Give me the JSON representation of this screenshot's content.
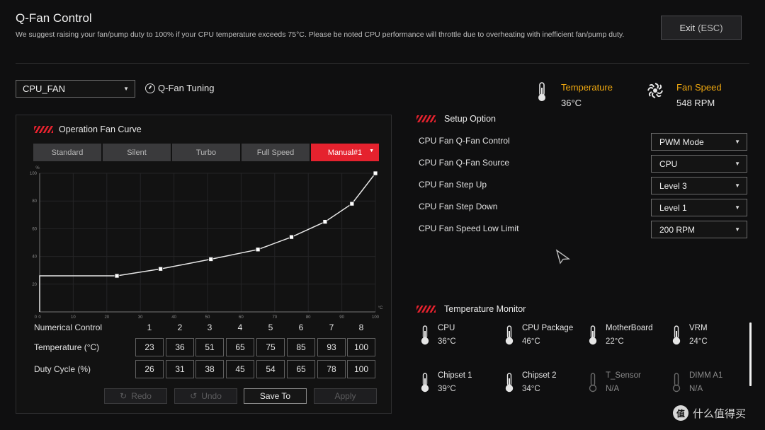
{
  "header": {
    "title": "Q-Fan Control",
    "subtitle": "We suggest raising your fan/pump duty to 100% if your CPU temperature exceeds 75°C. Please be noted CPU performance will throttle due to overheating with inefficient fan/pump duty.",
    "exit_label": "Exit",
    "exit_key": "(ESC)"
  },
  "fan_selector": {
    "value": "CPU_FAN"
  },
  "qfan_tuning_label": "Q-Fan Tuning",
  "stats": {
    "temperature_label": "Temperature",
    "temperature_value": "36°C",
    "fan_speed_label": "Fan Speed",
    "fan_speed_value": "548 RPM"
  },
  "curve_panel": {
    "title": "Operation Fan Curve",
    "tabs": [
      "Standard",
      "Silent",
      "Turbo",
      "Full Speed",
      "Manual#1"
    ],
    "active_tab": 4
  },
  "chart_data": {
    "type": "line",
    "title": "",
    "xlabel": "",
    "ylabel": "",
    "x_unit": "°C",
    "y_unit": "%",
    "xlim": [
      0,
      100
    ],
    "ylim": [
      0,
      100
    ],
    "xticks": [
      0,
      10,
      20,
      30,
      40,
      50,
      60,
      70,
      80,
      90,
      100
    ],
    "yticks": [
      20,
      40,
      60,
      80,
      100
    ],
    "points": [
      {
        "x": 23,
        "y": 26
      },
      {
        "x": 36,
        "y": 31
      },
      {
        "x": 51,
        "y": 38
      },
      {
        "x": 65,
        "y": 45
      },
      {
        "x": 75,
        "y": 54
      },
      {
        "x": 85,
        "y": 65
      },
      {
        "x": 93,
        "y": 78
      },
      {
        "x": 100,
        "y": 100
      }
    ],
    "grid": true
  },
  "numerical_control": {
    "label": "Numerical Control",
    "indices": [
      "1",
      "2",
      "3",
      "4",
      "5",
      "6",
      "7",
      "8"
    ],
    "temperature_label": "Temperature (°C)",
    "temperatures": [
      "23",
      "36",
      "51",
      "65",
      "75",
      "85",
      "93",
      "100"
    ],
    "duty_label": "Duty Cycle (%)",
    "duties": [
      "26",
      "31",
      "38",
      "45",
      "54",
      "65",
      "78",
      "100"
    ]
  },
  "actions": {
    "redo": "Redo",
    "undo": "Undo",
    "save": "Save To",
    "apply": "Apply"
  },
  "setup": {
    "title": "Setup Option",
    "options": [
      {
        "label": "CPU Fan Q-Fan Control",
        "value": "PWM Mode"
      },
      {
        "label": "CPU Fan Q-Fan Source",
        "value": "CPU"
      },
      {
        "label": "CPU Fan Step Up",
        "value": "Level 3"
      },
      {
        "label": "CPU Fan Step Down",
        "value": "Level 1"
      },
      {
        "label": "CPU Fan Speed Low Limit",
        "value": "200 RPM"
      }
    ]
  },
  "monitor": {
    "title": "Temperature Monitor",
    "items": [
      {
        "name": "CPU",
        "value": "36°C"
      },
      {
        "name": "CPU Package",
        "value": "46°C"
      },
      {
        "name": "MotherBoard",
        "value": "22°C"
      },
      {
        "name": "VRM",
        "value": "24°C"
      },
      {
        "name": "Chipset 1",
        "value": "39°C"
      },
      {
        "name": "Chipset 2",
        "value": "34°C"
      },
      {
        "name": "T_Sensor",
        "value": "N/A"
      },
      {
        "name": "DIMM A1",
        "value": "N/A"
      }
    ]
  },
  "watermark": {
    "text": "什么值得买",
    "logo_char": "值"
  },
  "colors": {
    "accent_red": "#e5222e",
    "label_orange": "#f0a80f",
    "background": "#0f0f10"
  }
}
